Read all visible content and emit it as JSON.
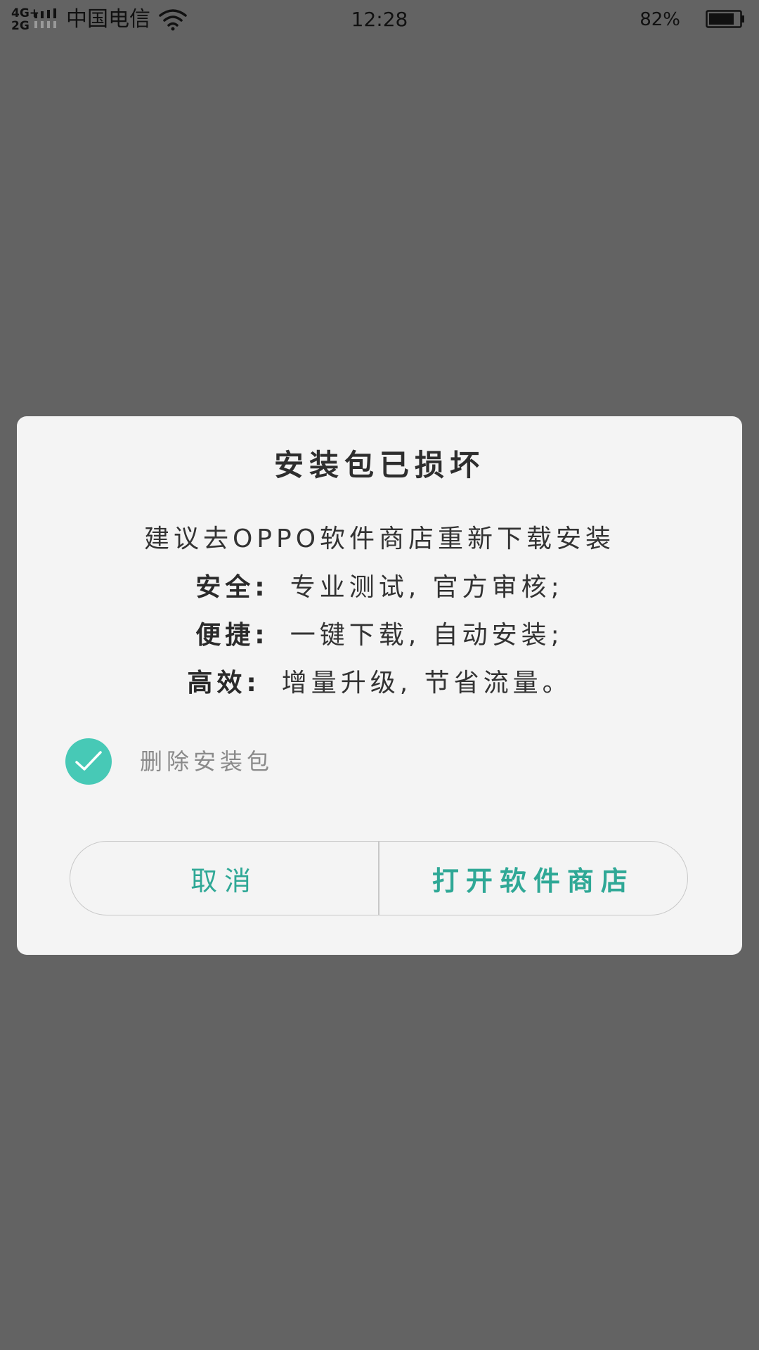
{
  "status_bar": {
    "network_type_top": "4G+",
    "network_type_bottom": "2G",
    "carrier": "中国电信",
    "time": "12:28",
    "battery_percent": "82%",
    "battery_level": 0.82
  },
  "dialog": {
    "title": "安装包已损坏",
    "description": "建议去OPPO软件商店重新下载安装",
    "features": [
      {
        "key": "安全:",
        "value": "专业测试, 官方审核;"
      },
      {
        "key": "便捷:",
        "value": "一键下载, 自动安装;"
      },
      {
        "key": "高效:",
        "value": "增量升级, 节省流量。"
      }
    ],
    "checkbox": {
      "label": "删除安装包",
      "checked": true,
      "color": "#47c9b6"
    },
    "buttons": {
      "cancel_label": "取消",
      "confirm_label": "打开软件商店",
      "accent_color": "#2fa896"
    }
  }
}
